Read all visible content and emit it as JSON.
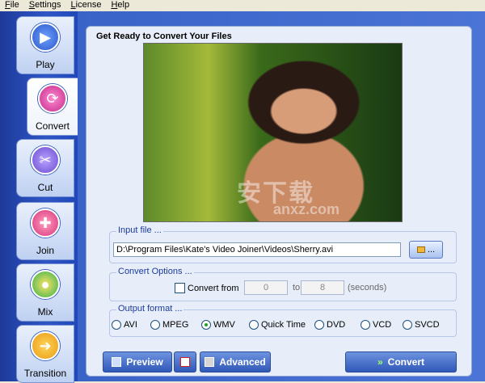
{
  "menu": [
    {
      "label": "File",
      "ul": "F",
      "rest": "ile"
    },
    {
      "label": "Settings",
      "ul": "S",
      "rest": "ettings"
    },
    {
      "label": "License",
      "ul": "L",
      "rest": "icense"
    },
    {
      "label": "Help",
      "ul": "H",
      "rest": "elp"
    }
  ],
  "sidebar": {
    "items": [
      {
        "label": "Play",
        "icon": "play-icon",
        "active": false
      },
      {
        "label": "Convert",
        "icon": "convert-icon",
        "active": true
      },
      {
        "label": "Cut",
        "icon": "scissors-icon",
        "active": false
      },
      {
        "label": "Join",
        "icon": "join-icon",
        "active": false
      },
      {
        "label": "Mix",
        "icon": "mix-icon",
        "active": false
      },
      {
        "label": "Transition",
        "icon": "transition-icon",
        "active": false
      }
    ]
  },
  "panel": {
    "title": "Get Ready to Convert Your Files"
  },
  "video": {
    "watermark": "安下载",
    "watermark_sub": "anxz.com"
  },
  "input_file": {
    "label": "Input file ...",
    "value": "D:\\Program Files\\Kate's Video Joiner\\Videos\\Sherry.avi",
    "browse_label": "..."
  },
  "convert_options": {
    "label": "Convert Options ...",
    "checkbox_label": "Convert from",
    "from": "0",
    "to_label": "to",
    "to": "8",
    "unit": "(seconds)"
  },
  "output_format": {
    "label": "Output format ...",
    "options": [
      "AVI",
      "MPEG",
      "WMV",
      "Quick Time",
      "DVD",
      "VCD",
      "SVCD"
    ],
    "selected": "WMV"
  },
  "buttons": {
    "preview": "Preview",
    "advanced": "Advanced",
    "convert": "Convert"
  }
}
